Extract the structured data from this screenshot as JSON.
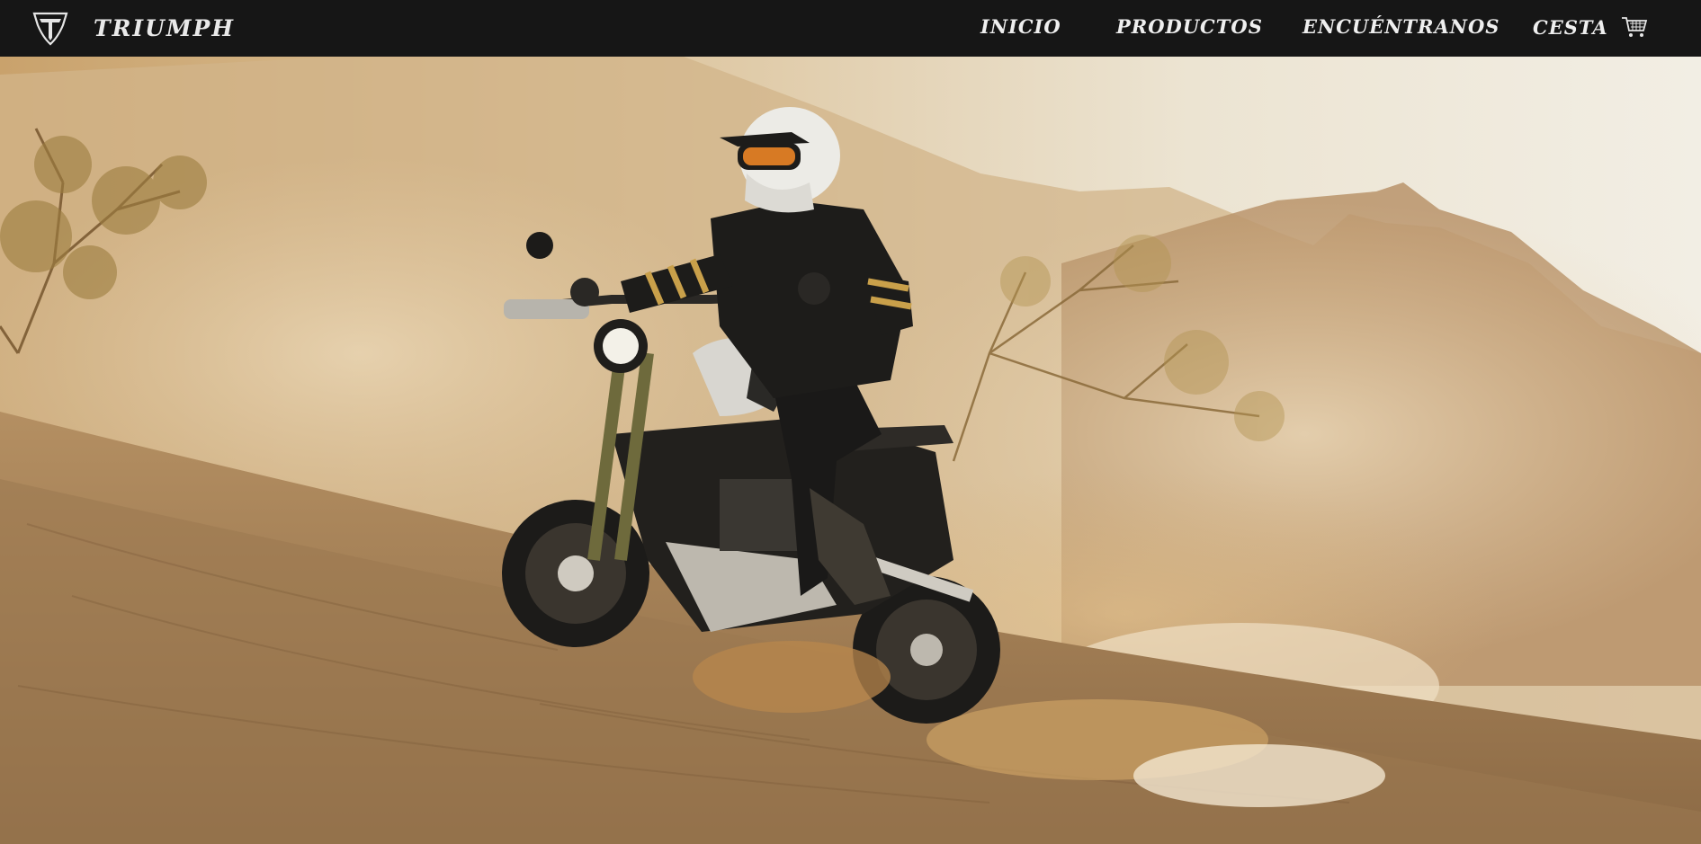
{
  "header": {
    "brand_name": "TRIUMPH",
    "logo_icon": "triumph-shield-logo-icon"
  },
  "nav": {
    "items": [
      {
        "label": "INICIO"
      },
      {
        "label": "PRODUCTOS"
      },
      {
        "label": "ENCUÉNTRANOS"
      },
      {
        "label": "CESTA",
        "icon": "cart-icon"
      }
    ]
  },
  "hero": {
    "image_subject": "motorcycle-rider-desert-dust-image"
  },
  "carousel": {
    "slide_count": 2,
    "active_index": 0
  },
  "colors": {
    "navbar_bg": "#161616",
    "nav_text": "#efefef",
    "sand": "#c8a574",
    "sky": "#efe9da"
  }
}
